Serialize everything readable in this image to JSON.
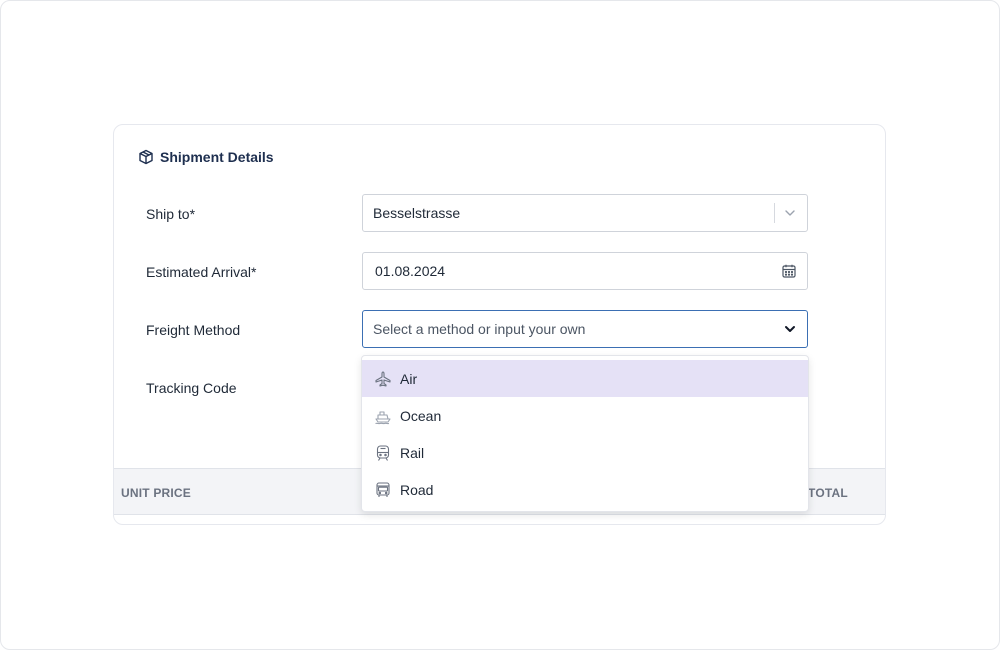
{
  "card": {
    "title": "Shipment Details",
    "title_icon": "package-icon"
  },
  "form": {
    "ship_to": {
      "label": "Ship to*",
      "value": "Besselstrasse"
    },
    "estimated_arrival": {
      "label": "Estimated Arrival*",
      "value": "01.08.2024"
    },
    "freight_method": {
      "label": "Freight Method",
      "placeholder": "Select a method or input your own"
    },
    "tracking_code": {
      "label": "Tracking Code"
    }
  },
  "table": {
    "columns": [
      "UNIT PRICE",
      "TOTAL"
    ]
  },
  "dropdown": {
    "options": [
      {
        "label": "Air",
        "icon": "plane-icon",
        "highlighted": true
      },
      {
        "label": "Ocean",
        "icon": "ship-icon",
        "highlighted": false
      },
      {
        "label": "Rail",
        "icon": "train-icon",
        "highlighted": false
      },
      {
        "label": "Road",
        "icon": "bus-icon",
        "highlighted": false
      }
    ]
  },
  "colors": {
    "focus_border": "#3b6fb3",
    "highlight": "#e5e1f6",
    "title": "#1e2f4f"
  }
}
